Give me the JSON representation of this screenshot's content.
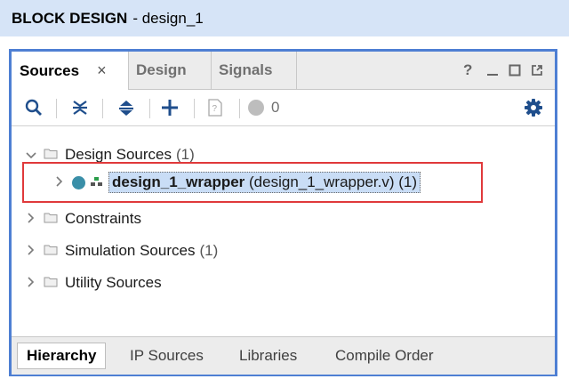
{
  "titlebar": {
    "title_bold": "BLOCK DESIGN",
    "title_rest": "- design_1"
  },
  "tabs": [
    {
      "label": "Sources",
      "active": true,
      "close": "×"
    },
    {
      "label": "Design"
    },
    {
      "label": "Signals"
    }
  ],
  "window_controls": {
    "help": "?",
    "minimize": "_",
    "maximize": "□",
    "float": "⧉"
  },
  "toolbar": {
    "error_count": "0"
  },
  "tree": {
    "design_sources": {
      "label": "Design Sources",
      "count": "(1)"
    },
    "wrapper": {
      "name": "design_1_wrapper",
      "file": "(design_1_wrapper.v)",
      "count": "(1)"
    },
    "constraints": {
      "label": "Constraints"
    },
    "simulation_sources": {
      "label": "Simulation Sources",
      "count": "(1)"
    },
    "utility_sources": {
      "label": "Utility Sources"
    }
  },
  "bottom_tabs": [
    {
      "label": "Hierarchy",
      "active": true
    },
    {
      "label": "IP Sources"
    },
    {
      "label": "Libraries"
    },
    {
      "label": "Compile Order"
    }
  ],
  "colors": {
    "accent": "#4e7fd3",
    "highlight": "#e0393b",
    "selection": "#c9ddf6"
  }
}
